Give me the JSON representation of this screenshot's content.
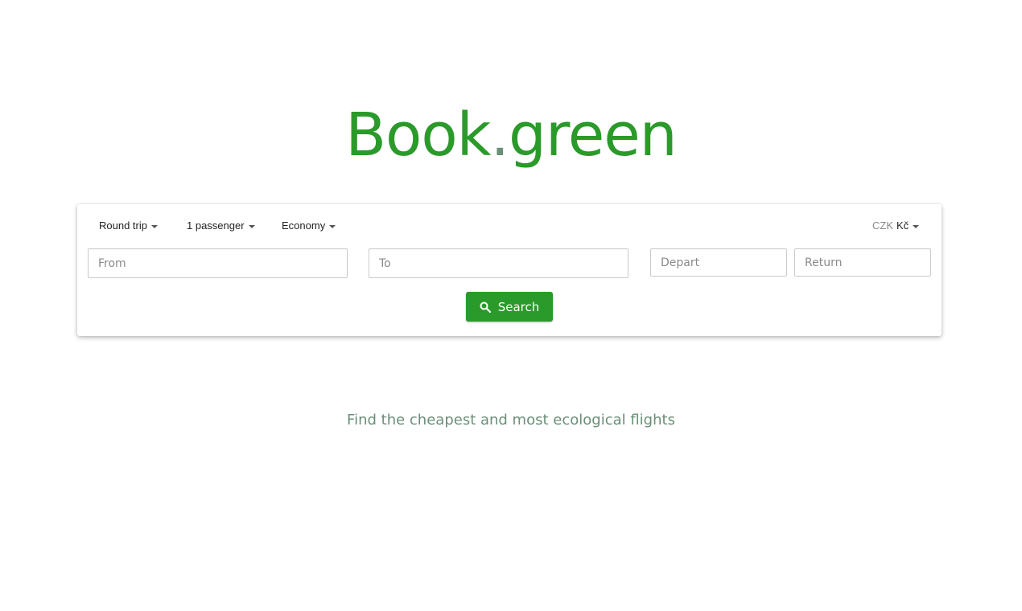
{
  "logo": {
    "name": "Book",
    "dot": ".",
    "tld": "green"
  },
  "options": {
    "trip_type": "Round trip",
    "passengers": "1 passenger",
    "cabin_class": "Economy",
    "currency_code": "CZK",
    "currency_symbol": "Kč"
  },
  "fields": {
    "from_placeholder": "From",
    "to_placeholder": "To",
    "depart_placeholder": "Depart",
    "return_placeholder": "Return"
  },
  "search_button": {
    "label": "Search"
  },
  "tagline": "Find the cheapest and most ecological flights",
  "colors": {
    "brand": "#2a9a2a",
    "tagline": "#6b8f78"
  }
}
